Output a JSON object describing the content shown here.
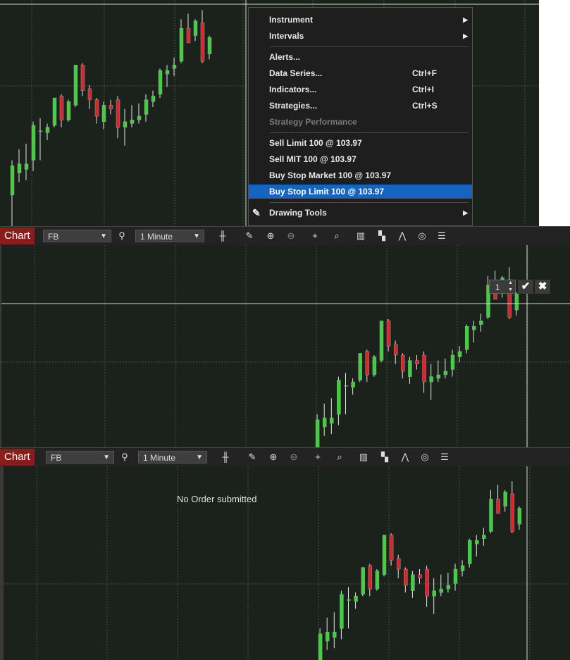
{
  "context_menu": {
    "items": [
      {
        "label": "Instrument",
        "shortcut": "",
        "submenu": true,
        "state": "normal"
      },
      {
        "label": "Intervals",
        "shortcut": "",
        "submenu": true,
        "state": "normal"
      },
      {
        "label": "Alerts...",
        "shortcut": "",
        "submenu": false,
        "state": "normal"
      },
      {
        "label": "Data Series...",
        "shortcut": "Ctrl+F",
        "submenu": false,
        "state": "normal"
      },
      {
        "label": "Indicators...",
        "shortcut": "Ctrl+I",
        "submenu": false,
        "state": "normal"
      },
      {
        "label": "Strategies...",
        "shortcut": "Ctrl+S",
        "submenu": false,
        "state": "normal"
      },
      {
        "label": "Strategy Performance",
        "shortcut": "",
        "submenu": false,
        "state": "disabled"
      },
      {
        "label": "Sell Limit 100 @ 103.97",
        "shortcut": "",
        "submenu": false,
        "state": "normal"
      },
      {
        "label": "Sell MIT 100 @ 103.97",
        "shortcut": "",
        "submenu": false,
        "state": "normal"
      },
      {
        "label": "Buy Stop Market 100 @ 103.97",
        "shortcut": "",
        "submenu": false,
        "state": "normal"
      },
      {
        "label": "Buy Stop Limit 100 @ 103.97",
        "shortcut": "",
        "submenu": false,
        "state": "highlighted"
      },
      {
        "label": "Drawing Tools",
        "shortcut": "",
        "submenu": true,
        "state": "normal",
        "icon": "pencil-icon"
      }
    ]
  },
  "toolbars": [
    {
      "tab": "Chart",
      "instrument": "FB",
      "interval": "1 Minute"
    },
    {
      "tab": "Chart",
      "instrument": "FB",
      "interval": "1 Minute"
    }
  ],
  "order_widget": {
    "quantity": "1",
    "confirm_icon": "checkmark-icon",
    "cancel_icon": "close-icon"
  },
  "status_message": "No Order submitted",
  "colors": {
    "background": "#1b211b",
    "up": "#3cd23c",
    "down": "#e0202a",
    "grid": "#4a4f4a",
    "crosshair": "#d8d8d8",
    "highlight": "#1565c0",
    "tab": "#8b1c1c"
  },
  "toolbar_icons": [
    "search-icon",
    "bar-type-icon",
    "pencil-icon",
    "zoom-in-icon",
    "zoom-out-icon",
    "crosshair-icon",
    "data-box-icon",
    "chart-trader-icon",
    "template-icon",
    "strategy-icon",
    "refresh-icon",
    "properties-icon"
  ],
  "chart_data": {
    "type": "candlestick",
    "candles": [
      {
        "o": 0,
        "h": 0,
        "l": 0,
        "c": 0
      },
      {
        "o": 17,
        "h": 36,
        "l": 0,
        "c": 33
      },
      {
        "o": 29,
        "h": 42,
        "l": 24,
        "c": 34
      },
      {
        "o": 31,
        "h": 45,
        "l": 25,
        "c": 34
      },
      {
        "o": 36,
        "h": 57,
        "l": 30,
        "c": 55
      },
      {
        "o": 52,
        "h": 59,
        "l": 36,
        "c": 52
      },
      {
        "o": 51,
        "h": 56,
        "l": 47,
        "c": 54
      },
      {
        "o": 55,
        "h": 70,
        "l": 54,
        "c": 70
      },
      {
        "o": 71,
        "h": 72,
        "l": 54,
        "c": 58
      },
      {
        "o": 58,
        "h": 69,
        "l": 57,
        "c": 68
      },
      {
        "o": 66,
        "h": 88,
        "l": 65,
        "c": 88
      },
      {
        "o": 88,
        "h": 89,
        "l": 71,
        "c": 74
      },
      {
        "o": 75,
        "h": 77,
        "l": 64,
        "c": 69
      },
      {
        "o": 69,
        "h": 70,
        "l": 56,
        "c": 60
      },
      {
        "o": 57,
        "h": 68,
        "l": 53,
        "c": 66
      },
      {
        "o": 66,
        "h": 69,
        "l": 61,
        "c": 64
      },
      {
        "o": 69,
        "h": 71,
        "l": 48,
        "c": 54
      },
      {
        "o": 54,
        "h": 64,
        "l": 44,
        "c": 57
      },
      {
        "o": 56,
        "h": 66,
        "l": 54,
        "c": 58
      },
      {
        "o": 58,
        "h": 67,
        "l": 56,
        "c": 60
      },
      {
        "o": 61,
        "h": 72,
        "l": 57,
        "c": 69
      },
      {
        "o": 68,
        "h": 74,
        "l": 65,
        "c": 71
      },
      {
        "o": 72,
        "h": 86,
        "l": 70,
        "c": 85
      },
      {
        "o": 83,
        "h": 88,
        "l": 76,
        "c": 85
      },
      {
        "o": 86,
        "h": 92,
        "l": 82,
        "c": 88
      },
      {
        "o": 90,
        "h": 113,
        "l": 89,
        "c": 108
      },
      {
        "o": 108,
        "h": 116,
        "l": 105,
        "c": 100
      },
      {
        "o": 104,
        "h": 113,
        "l": 101,
        "c": 112
      },
      {
        "o": 111,
        "h": 118,
        "l": 89,
        "c": 90
      },
      {
        "o": 94,
        "h": 104,
        "l": 91,
        "c": 103
      }
    ]
  }
}
